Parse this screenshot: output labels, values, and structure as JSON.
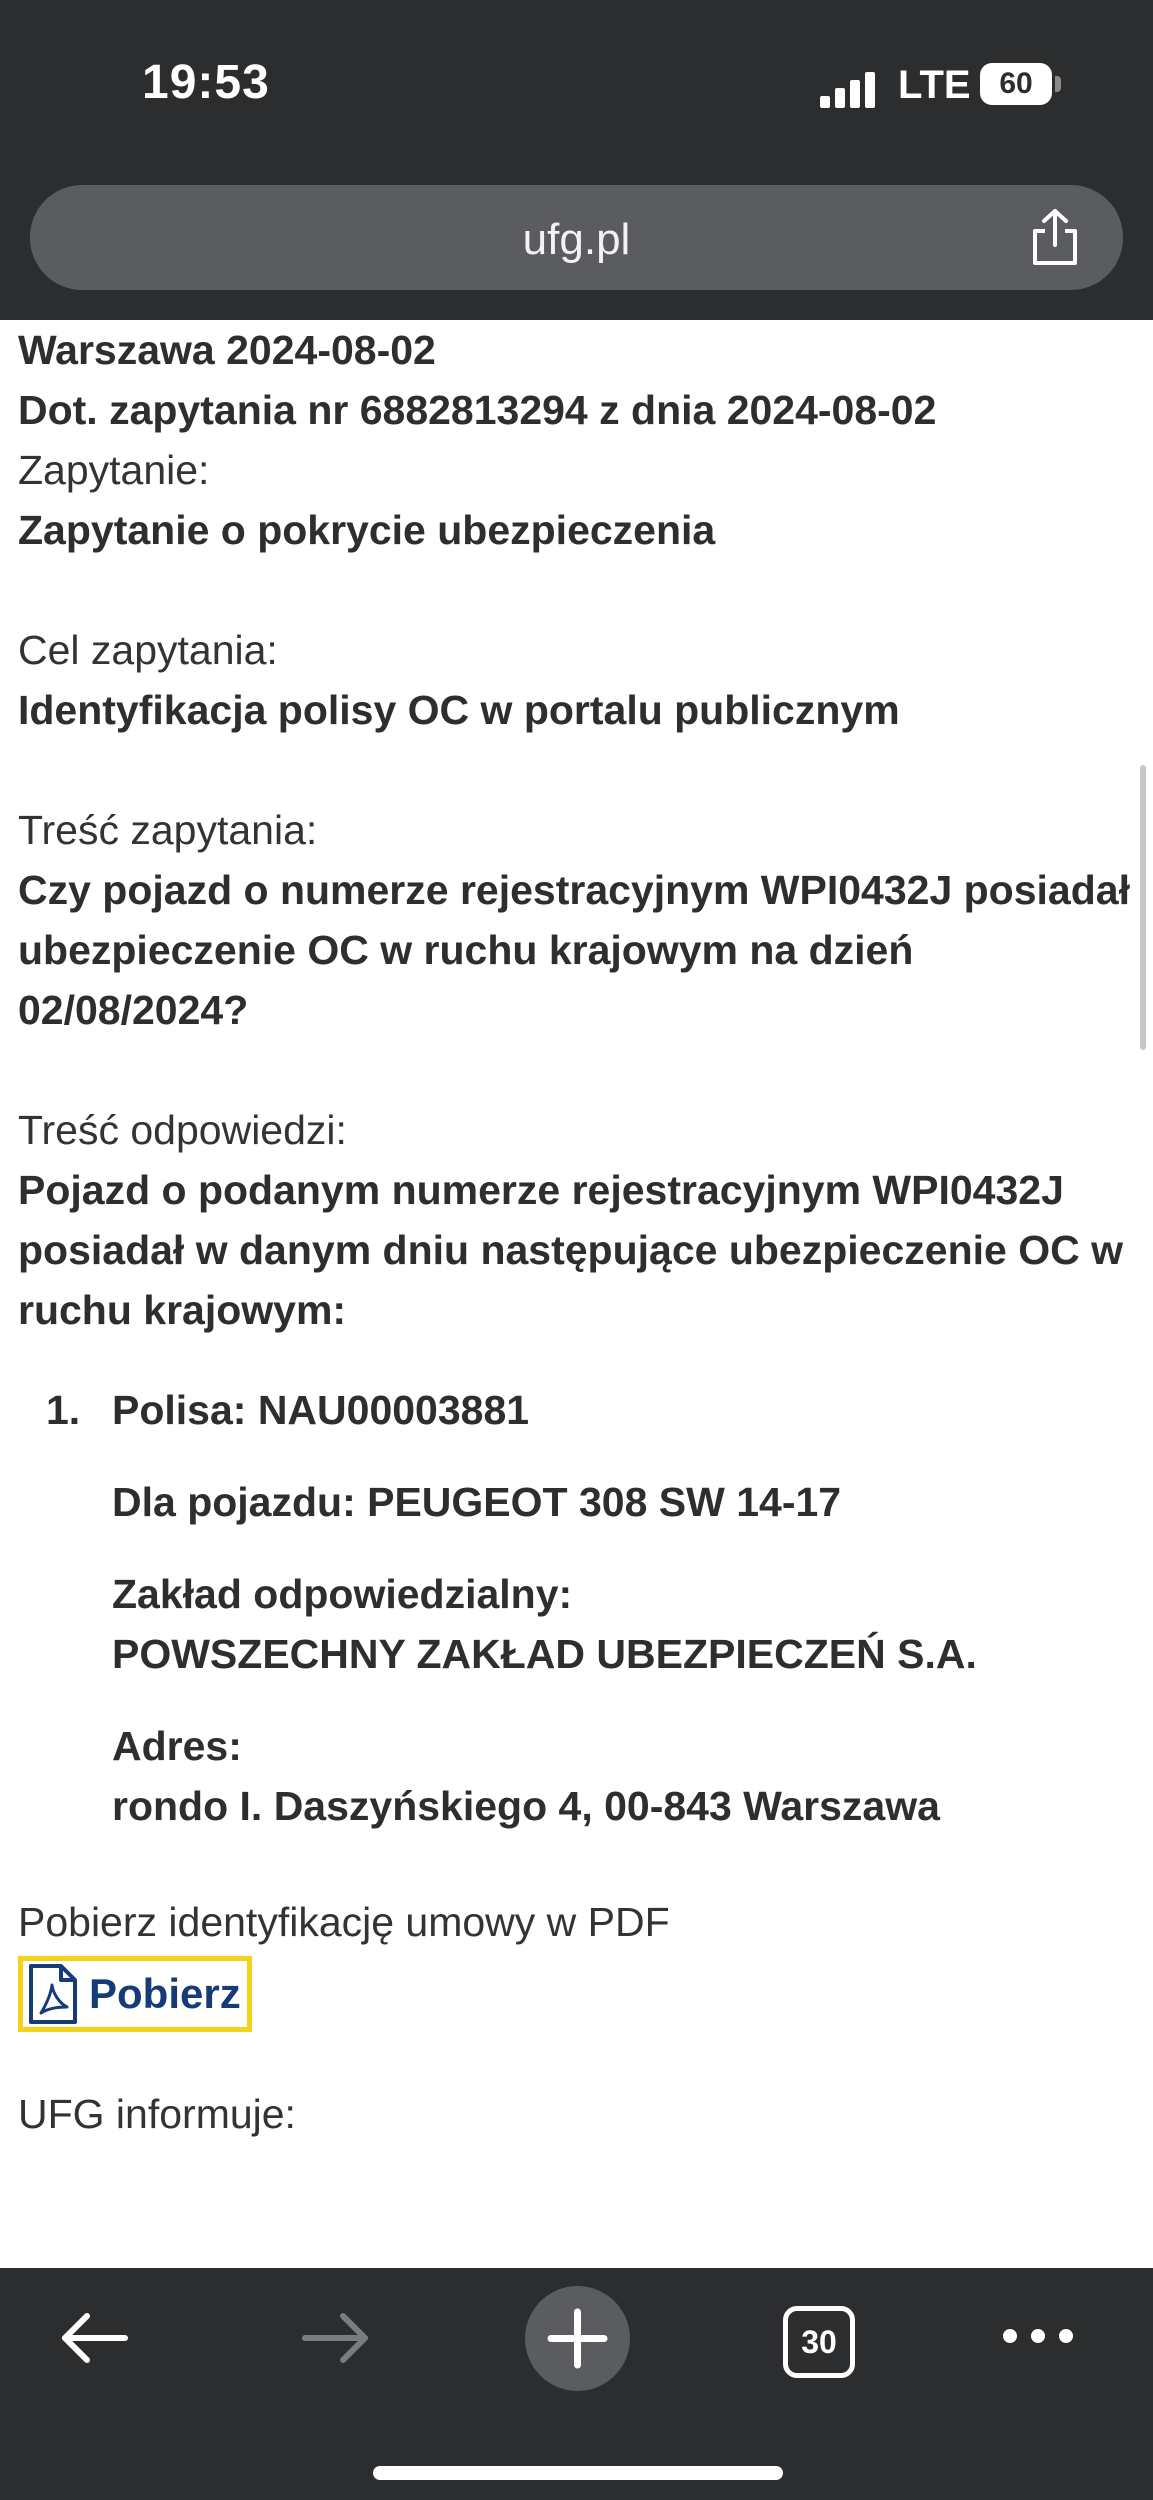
{
  "status": {
    "time": "19:53",
    "network": "LTE",
    "battery": "60"
  },
  "browser": {
    "url": "ufg.pl",
    "tab_count": "30",
    "icons": {
      "share": "share-icon",
      "back": "arrow-left-icon",
      "forward": "arrow-right-icon",
      "new_tab": "plus-icon",
      "tabs": "tabs-icon",
      "more": "more-icon"
    }
  },
  "letter": {
    "place_date": "Warszawa 2024-08-02",
    "reference": "Dot. zapytania nr 6882813294 z dnia 2024-08-02",
    "query_label": "Zapytanie:",
    "query_value": "Zapytanie o pokrycie ubezpieczenia",
    "purpose_label": "Cel zapytania:",
    "purpose_value": "Identyfikacja polisy OC w portalu publicznym",
    "question_label": "Treść zapytania:",
    "question_value": "Czy pojazd o numerze rejestracyjnym WPI0432J posiadał ubezpieczenie OC w ruchu krajowym na dzień 02/08/2024?",
    "answer_label": "Treść odpowiedzi:",
    "answer_value": "Pojazd o podanym numerze rejestracyjnym WPI0432J posiadał w danym dniu następujące ubezpieczenie OC w ruchu krajowym:",
    "policies": [
      {
        "number": "1.",
        "policy": "Polisa: NAU00003881",
        "vehicle": "Dla pojazdu: PEUGEOT 308 SW 14-17",
        "insurer_label": "Zakład odpowiedzialny:",
        "insurer_value": "POWSZECHNY ZAKŁAD UBEZPIECZEŃ S.A.",
        "address_label": "Adres:",
        "address_value": "rondo I. Daszyńskiego 4, 00-843 Warszawa"
      }
    ],
    "download_label": "Pobierz identyfikację umowy w PDF",
    "download_button": "Pobierz",
    "ufg_info_label": "UFG informuje:"
  },
  "colors": {
    "chrome": "#2b2d2f",
    "url_pill": "#5a5c5f",
    "link": "#173a78",
    "focus_outline": "#f2d21b"
  }
}
